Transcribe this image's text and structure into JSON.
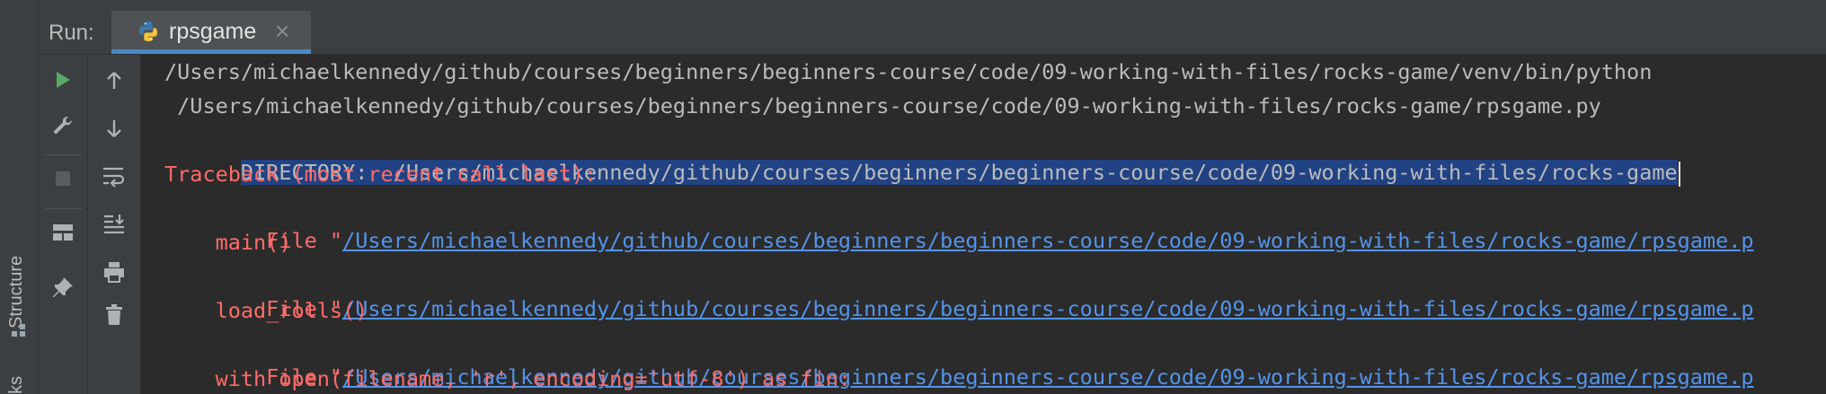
{
  "side_panel": {
    "structure_label": "Structure",
    "bookmarks_label_partial": "ks"
  },
  "run_panel": {
    "run_label": "Run:",
    "tab": {
      "label": "rpsgame",
      "close_glyph": "×",
      "icon": "python-icon"
    }
  },
  "toolbar": {
    "left": [
      "run-icon",
      "wrench-icon",
      "stop-icon",
      "layout-icon",
      "pin-icon"
    ],
    "right": [
      "arrow-up-icon",
      "arrow-down-icon",
      "soft-wrap-icon",
      "scroll-to-end-icon",
      "print-icon",
      "trash-icon"
    ]
  },
  "console": {
    "line1": "/Users/michaelkennedy/github/courses/beginners/beginners-course/code/09-working-with-files/rocks-game/venv/bin/python",
    "line2": " /Users/michaelkennedy/github/courses/beginners/beginners-course/code/09-working-with-files/rocks-game/rpsgame.py",
    "line3": "DIRECTORY:  /Users/michaelkennedy/github/courses/beginners/beginners-course/code/09-working-with-files/rocks-game",
    "line4": "Traceback (most recent call last):",
    "file_prefix": "  File \"",
    "file_link": "/Users/michaelkennedy/github/courses/beginners/beginners-course/code/09-working-with-files/rocks-game/rpsgame.p",
    "call1": "    main()",
    "call2": "    load_rolls()",
    "call3": "    with open(filename, 'r', encoding='utf-8') as fin:"
  },
  "colors": {
    "background": "#2b2b2b",
    "error": "#ff6b68",
    "link": "#5394ec",
    "selection": "#214283",
    "tab_underline": "#4a88c7"
  }
}
